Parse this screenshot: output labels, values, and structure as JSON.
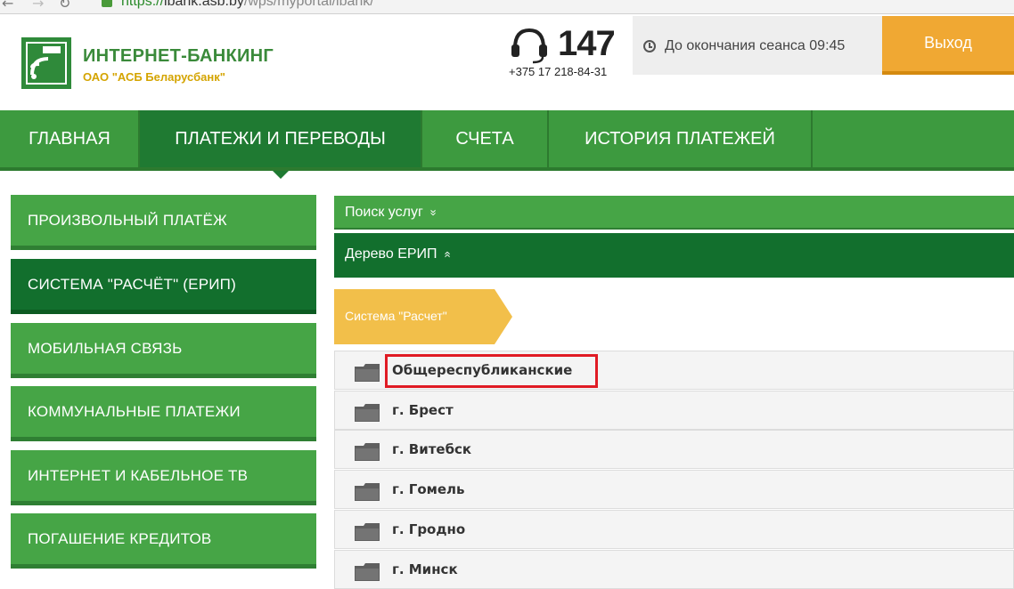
{
  "browser": {
    "url_scheme": "https://",
    "url_host": "ibank.asb.by",
    "url_path": "/wps/myportal/ibank/"
  },
  "header": {
    "brand_title": "ИНТЕРНЕТ-БАНКИНГ",
    "brand_subtitle": "ОАО \"АСБ Беларусбанк\"",
    "phone_short": "147",
    "phone_full": "+375 17 218-84-31",
    "session_label": "До окончания сеанса 09:45",
    "logout_label": "Выход"
  },
  "topnav": {
    "tabs": [
      {
        "label": "ГЛАВНАЯ"
      },
      {
        "label": "ПЛАТЕЖИ И ПЕРЕВОДЫ"
      },
      {
        "label": "СЧЕТА"
      },
      {
        "label": "ИСТОРИЯ ПЛАТЕЖЕЙ"
      }
    ],
    "active_index": 1
  },
  "sidebar": {
    "items": [
      {
        "label": "ПРОИЗВОЛЬНЫЙ ПЛАТЁЖ"
      },
      {
        "label": "СИСТЕМА \"РАСЧЁТ\" (ЕРИП)"
      },
      {
        "label": "МОБИЛЬНАЯ СВЯЗЬ"
      },
      {
        "label": "КОММУНАЛЬНЫЕ ПЛАТЕЖИ"
      },
      {
        "label": "ИНТЕРНЕТ И КАБЕЛЬНОЕ ТВ"
      },
      {
        "label": "ПОГАШЕНИЕ КРЕДИТОВ"
      }
    ],
    "active_index": 1
  },
  "panel": {
    "search_label": "Поиск услуг",
    "search_chevron": "»",
    "tree_label": "Дерево ЕРИП",
    "tree_chevron": "«",
    "breadcrumb": "Система \"Расчет\"",
    "rows": [
      {
        "label": "Общереспубликанские"
      },
      {
        "label": "г. Брест"
      },
      {
        "label": "г. Витебск"
      },
      {
        "label": "г. Гомель"
      },
      {
        "label": "г. Гродно"
      },
      {
        "label": "г. Минск"
      }
    ],
    "highlighted_index": 0
  },
  "colors": {
    "brand_green": "#46a546",
    "dark_green": "#126f2d",
    "accent_orange": "#f0a833",
    "crumb_yellow": "#f2bf4a",
    "highlight_red": "#e01b24"
  }
}
